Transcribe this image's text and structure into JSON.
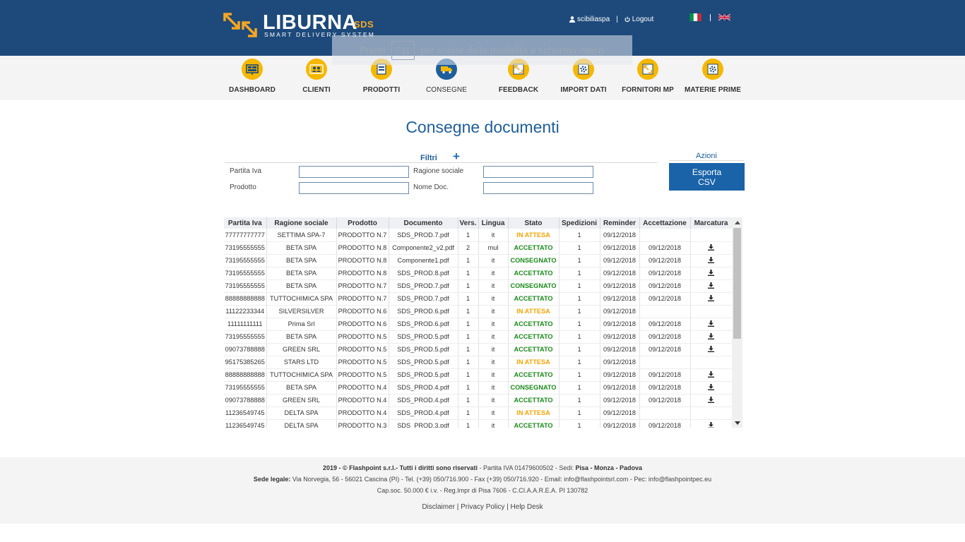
{
  "brand": {
    "name": "LIBURNA",
    "suffix": "SDS",
    "tagline": "SMART DELIVERY SYSTEM",
    "accent_color": "#f5a623",
    "header_color": "#1e4a7b"
  },
  "user": {
    "username": "scibiliaspa",
    "logout_label": "Logout",
    "languages": [
      "it",
      "en"
    ]
  },
  "fullscreen_hint": {
    "prefix": "Premi",
    "key": "F11",
    "suffix": "per uscire dalla modalità a schermo intero"
  },
  "nav": [
    {
      "label": "DASHBOARD",
      "icon": "dashboard-icon",
      "active": false
    },
    {
      "label": "CLIENTI",
      "icon": "clients-icon",
      "active": false
    },
    {
      "label": "PRODOTTI",
      "icon": "products-icon",
      "active": false
    },
    {
      "label": "CONSEGNE",
      "icon": "truck-icon",
      "active": true
    },
    {
      "label": "FEEDBACK",
      "icon": "feedback-icon",
      "active": false
    },
    {
      "label": "IMPORT DATI",
      "icon": "import-icon",
      "active": false
    },
    {
      "label": "FORNITORI MP",
      "icon": "suppliers-icon",
      "active": false
    },
    {
      "label": "MATERIE PRIME",
      "icon": "raw-materials-icon",
      "active": false
    }
  ],
  "page": {
    "title": "Consegne documenti"
  },
  "filters": {
    "title": "Filtri",
    "expand": "+",
    "partita_iva_label": "Partita Iva",
    "ragione_sociale_label": "Ragione sociale",
    "prodotto_label": "Prodotto",
    "nome_doc_label": "Nome Doc.",
    "partita_iva_value": "",
    "ragione_sociale_value": "",
    "prodotto_value": "",
    "nome_doc_value": ""
  },
  "actions": {
    "title": "Azioni",
    "export_line1": "Esporta",
    "export_line2": "CSV"
  },
  "table": {
    "columns": [
      "Partita Iva",
      "Ragione sociale",
      "Prodotto",
      "Documento",
      "Vers.",
      "Lingua",
      "Stato",
      "Spedizioni",
      "Reminder",
      "Accettazione",
      "Marcatura"
    ],
    "rows": [
      {
        "piva": "77777777777",
        "ragione": "SETTIMA SPA-7",
        "prodotto": "PRODOTTO N.7",
        "documento": "SDS_PROD.7.pdf",
        "vers": "1",
        "lingua": "it",
        "stato": "IN ATTESA",
        "spedizioni": "1",
        "reminder": "09/12/2018",
        "accettazione": "",
        "marcatura": false
      },
      {
        "piva": "73195555555",
        "ragione": "BETA SPA",
        "prodotto": "PRODOTTO N.8",
        "documento": "Componente2_v2.pdf",
        "vers": "2",
        "lingua": "mul",
        "stato": "ACCETTATO",
        "spedizioni": "1",
        "reminder": "09/12/2018",
        "accettazione": "09/12/2018",
        "marcatura": true
      },
      {
        "piva": "73195555555",
        "ragione": "BETA SPA",
        "prodotto": "PRODOTTO N.8",
        "documento": "Componente1.pdf",
        "vers": "1",
        "lingua": "it",
        "stato": "CONSEGNATO",
        "spedizioni": "1",
        "reminder": "09/12/2018",
        "accettazione": "09/12/2018",
        "marcatura": true
      },
      {
        "piva": "73195555555",
        "ragione": "BETA SPA",
        "prodotto": "PRODOTTO N.8",
        "documento": "SDS_PROD.8.pdf",
        "vers": "1",
        "lingua": "it",
        "stato": "ACCETTATO",
        "spedizioni": "1",
        "reminder": "09/12/2018",
        "accettazione": "09/12/2018",
        "marcatura": true
      },
      {
        "piva": "73195555555",
        "ragione": "BETA SPA",
        "prodotto": "PRODOTTO N.7",
        "documento": "SDS_PROD.7.pdf",
        "vers": "1",
        "lingua": "it",
        "stato": "CONSEGNATO",
        "spedizioni": "1",
        "reminder": "09/12/2018",
        "accettazione": "09/12/2018",
        "marcatura": true
      },
      {
        "piva": "88888888888",
        "ragione": "TUTTOCHIMICA SPA",
        "prodotto": "PRODOTTO N.7",
        "documento": "SDS_PROD.7.pdf",
        "vers": "1",
        "lingua": "it",
        "stato": "ACCETTATO",
        "spedizioni": "1",
        "reminder": "09/12/2018",
        "accettazione": "09/12/2018",
        "marcatura": true
      },
      {
        "piva": "11122233344",
        "ragione": "SILVERSILVER",
        "prodotto": "PRODOTTO N.6",
        "documento": "SDS_PROD.6.pdf",
        "vers": "1",
        "lingua": "it",
        "stato": "IN ATTESA",
        "spedizioni": "1",
        "reminder": "09/12/2018",
        "accettazione": "",
        "marcatura": false
      },
      {
        "piva": "11111111111",
        "ragione": "Prima Srl",
        "prodotto": "PRODOTTO N.6",
        "documento": "SDS_PROD.6.pdf",
        "vers": "1",
        "lingua": "it",
        "stato": "ACCETTATO",
        "spedizioni": "1",
        "reminder": "09/12/2018",
        "accettazione": "09/12/2018",
        "marcatura": true
      },
      {
        "piva": "73195555555",
        "ragione": "BETA SPA",
        "prodotto": "PRODOTTO N.5",
        "documento": "SDS_PROD.5.pdf",
        "vers": "1",
        "lingua": "it",
        "stato": "ACCETTATO",
        "spedizioni": "1",
        "reminder": "09/12/2018",
        "accettazione": "09/12/2018",
        "marcatura": true
      },
      {
        "piva": "09073788888",
        "ragione": "GREEN SRL",
        "prodotto": "PRODOTTO N.5",
        "documento": "SDS_PROD.5.pdf",
        "vers": "1",
        "lingua": "it",
        "stato": "ACCETTATO",
        "spedizioni": "1",
        "reminder": "09/12/2018",
        "accettazione": "09/12/2018",
        "marcatura": true
      },
      {
        "piva": "95175385265",
        "ragione": "STARS LTD",
        "prodotto": "PRODOTTO N.5",
        "documento": "SDS_PROD.5.pdf",
        "vers": "1",
        "lingua": "it",
        "stato": "IN ATTESA",
        "spedizioni": "1",
        "reminder": "09/12/2018",
        "accettazione": "",
        "marcatura": false
      },
      {
        "piva": "88888888888",
        "ragione": "TUTTOCHIMICA SPA",
        "prodotto": "PRODOTTO N.5",
        "documento": "SDS_PROD.5.pdf",
        "vers": "1",
        "lingua": "it",
        "stato": "ACCETTATO",
        "spedizioni": "1",
        "reminder": "09/12/2018",
        "accettazione": "09/12/2018",
        "marcatura": true
      },
      {
        "piva": "73195555555",
        "ragione": "BETA SPA",
        "prodotto": "PRODOTTO N.4",
        "documento": "SDS_PROD.4.pdf",
        "vers": "1",
        "lingua": "it",
        "stato": "CONSEGNATO",
        "spedizioni": "1",
        "reminder": "09/12/2018",
        "accettazione": "09/12/2018",
        "marcatura": true
      },
      {
        "piva": "09073788888",
        "ragione": "GREEN SRL",
        "prodotto": "PRODOTTO N.4",
        "documento": "SDS_PROD.4.pdf",
        "vers": "1",
        "lingua": "it",
        "stato": "ACCETTATO",
        "spedizioni": "1",
        "reminder": "09/12/2018",
        "accettazione": "09/12/2018",
        "marcatura": true
      },
      {
        "piva": "11236549745",
        "ragione": "DELTA SPA",
        "prodotto": "PRODOTTO N.4",
        "documento": "SDS_PROD.4.pdf",
        "vers": "1",
        "lingua": "it",
        "stato": "IN ATTESA",
        "spedizioni": "1",
        "reminder": "09/12/2018",
        "accettazione": "",
        "marcatura": false
      },
      {
        "piva": "11236549745",
        "ragione": "DELTA SPA",
        "prodotto": "PRODOTTO N.3",
        "documento": "SDS_PROD.3.pdf",
        "vers": "1",
        "lingua": "it",
        "stato": "ACCETTATO",
        "spedizioni": "1",
        "reminder": "09/12/2018",
        "accettazione": "09/12/2018",
        "marcatura": true
      }
    ]
  },
  "status_colors": {
    "IN ATTESA": "#f5a300",
    "ACCETTATO": "#1a8a1a",
    "CONSEGNATO": "#1a8a1a"
  },
  "footer": {
    "line1": {
      "copyright": "2019 - © Flashpoint s.r.l.- Tutti i diritti sono riservati",
      "piva": " - Partita IVA 01479600502 - Sedi: ",
      "sedi": "Pisa - Monza - Padova"
    },
    "line2": {
      "label": "Sede legale:",
      "text": " Via Norvegia, 56 - 56021 Cascina (PI) - Tel. (+39) 050/716.900 - Fax (+39) 050/716.920 - Email: info@flashpointsrl.com - Pec: info@flashpointpec.eu"
    },
    "line3": "Cap.soc. 50.000 € i.v. - Reg.Impr di Pisa 7606 - C.CI.A.A.R.E.A. PI 130782",
    "links": {
      "disclaimer": "Disclaimer",
      "privacy": "Privacy Policy",
      "helpdesk": "Help Desk",
      "separator": " | "
    }
  }
}
